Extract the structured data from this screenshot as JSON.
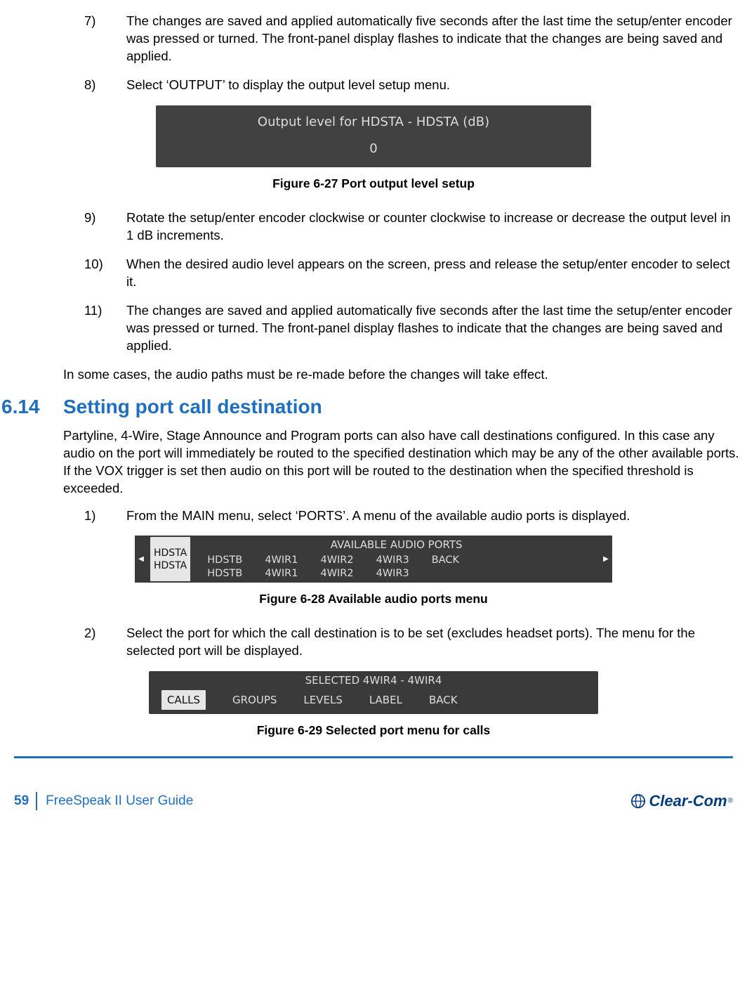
{
  "items": {
    "i7": {
      "num": "7)",
      "text": "The changes are saved and applied automatically five seconds after the last time the setup/enter encoder was pressed or turned. The front-panel display flashes to indicate that the changes are being saved and applied."
    },
    "i8": {
      "num": "8)",
      "text": "Select ‘OUTPUT’ to display the output level setup menu."
    },
    "i9": {
      "num": "9)",
      "text": "Rotate the setup/enter encoder clockwise or counter clockwise to increase or decrease the output level in 1 dB increments."
    },
    "i10": {
      "num": "10)",
      "text": "When the desired audio level appears on the screen, press and release the setup/enter encoder to select it."
    },
    "i11": {
      "num": "11)",
      "text": "The changes are saved and applied automatically five seconds after the last time the setup/enter encoder was pressed or turned. The front-panel display flashes to indicate that the changes are being saved and applied."
    }
  },
  "fig27": {
    "line1": "Output level for HDSTA - HDSTA (dB)",
    "line2": "0",
    "caption": "Figure 6-27 Port output level setup"
  },
  "para_after_11": "In some cases, the audio paths must be re-made before the changes will take effect.",
  "section": {
    "num": "6.14",
    "title": "Setting port call destination",
    "intro": "Partyline, 4-Wire, Stage Announce and Program ports can also have call destinations configured. In this case any audio on the port will immediately be routed to the specified destination which may be any of the other available ports. If the VOX trigger is set then audio on this port will be routed to the destination when the specified threshold is exceeded."
  },
  "s_items": {
    "s1": {
      "num": "1)",
      "text": "From the MAIN menu, select ‘PORTS’. A menu of the available audio ports is displayed."
    },
    "s2": {
      "num": "2)",
      "text": "Select the port for which the call destination is to be set (excludes headset ports). The menu for the selected port will be displayed."
    }
  },
  "fig28": {
    "title": "AVAILABLE AUDIO PORTS",
    "hl1": "HDSTA",
    "hl2": "HDSTA",
    "c1a": "HDSTB",
    "c1b": "HDSTB",
    "c2a": "4WIR1",
    "c2b": "4WIR1",
    "c3a": "4WIR2",
    "c3b": "4WIR2",
    "c4a": "4WIR3",
    "c4b": "4WIR3",
    "c5a": "BACK",
    "caption": "Figure 6-28 Available audio ports menu"
  },
  "fig29": {
    "title": "SELECTED 4WIR4 - 4WIR4",
    "m1": "CALLS",
    "m2": "GROUPS",
    "m3": "LEVELS",
    "m4": "LABEL",
    "m5": "BACK",
    "caption": "Figure 6-29 Selected port menu for calls"
  },
  "footer": {
    "page": "59",
    "guide": "FreeSpeak II User Guide",
    "brand": "Clear-Com"
  }
}
